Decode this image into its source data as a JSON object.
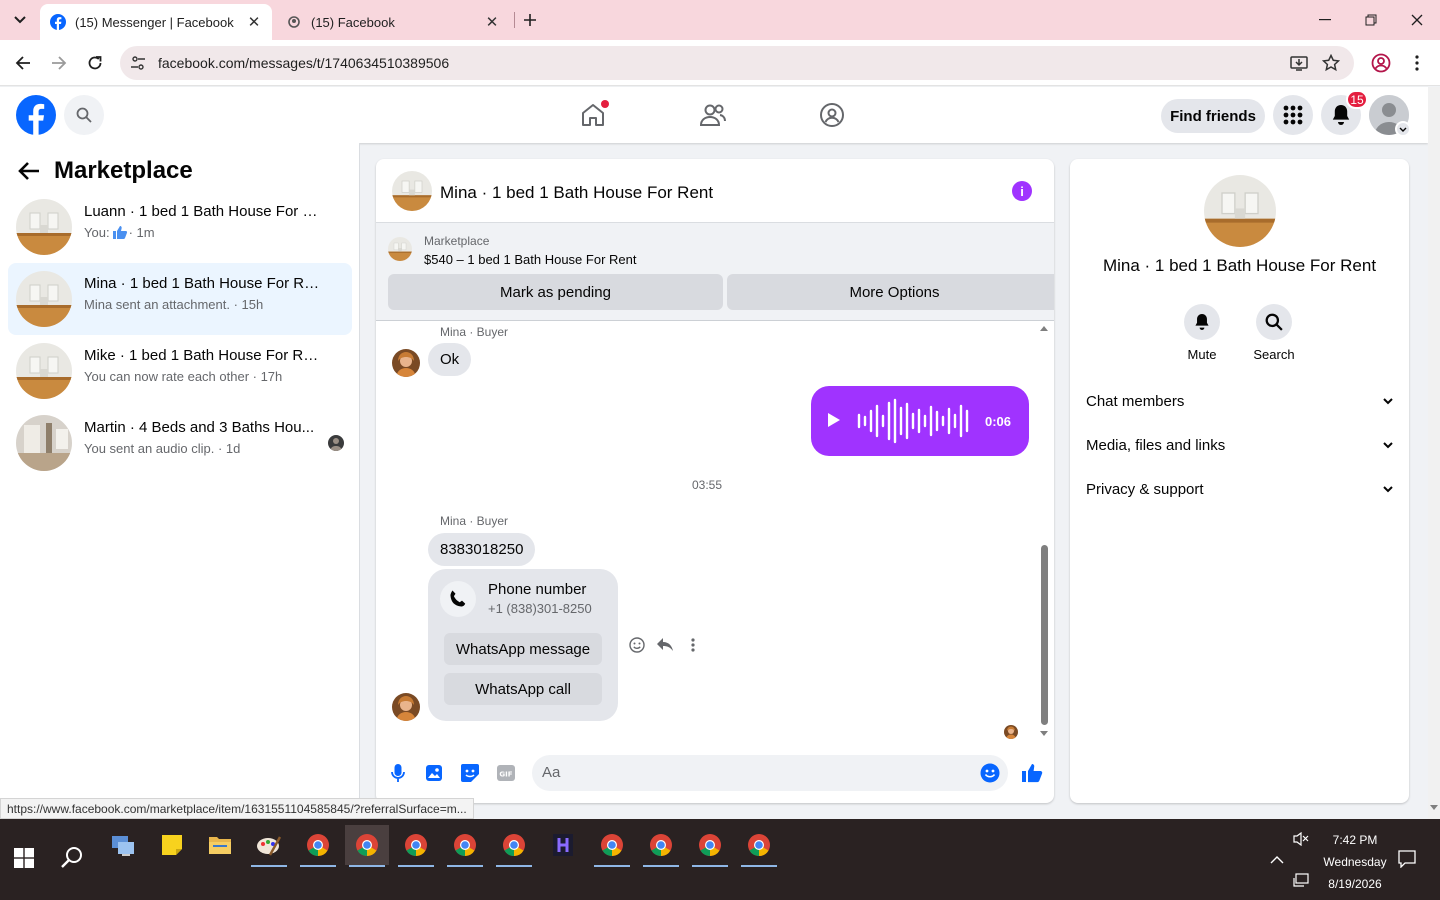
{
  "browser": {
    "tabs": [
      {
        "title": "(15) Messenger | Facebook",
        "active": true
      },
      {
        "title": "(15) Facebook",
        "active": false
      }
    ],
    "url": "facebook.com/messages/t/1740634510389506",
    "status_url": "https://www.facebook.com/marketplace/item/1631551104585845/?referralSurface=m..."
  },
  "header": {
    "find_friends": "Find friends",
    "notification_count": "15",
    "icons": [
      "facebook-logo",
      "search-icon",
      "home-icon",
      "friends-icon",
      "groups-icon",
      "grid-menu-icon",
      "bell-icon",
      "avatar"
    ]
  },
  "sidebar": {
    "title": "Marketplace",
    "conversations": [
      {
        "name": "Luann · 1 bed 1 Bath House For Rent",
        "preview_prefix": "You:",
        "preview": " · 1m",
        "selected": false,
        "has_like": true
      },
      {
        "name": "Mina · 1 bed 1 Bath House For Rent",
        "preview_prefix": "",
        "preview": "Mina sent an attachment. · 15h",
        "selected": true
      },
      {
        "name": "Mike · 1 bed 1 Bath House For Rent",
        "preview_prefix": "",
        "preview": "You can now rate each other · 17h",
        "selected": false
      },
      {
        "name": "Martin · 4 Beds and 3 Baths Hou...",
        "preview_prefix": "",
        "preview": "You sent an audio clip. · 1d",
        "selected": false
      }
    ]
  },
  "chat": {
    "title": "Mina · 1 bed 1 Bath House For Rent",
    "listing_tag": "Marketplace",
    "listing_price": "$540 – 1 bed 1 Bath House For Rent",
    "mark_pending": "Mark as pending",
    "more_options": "More Options",
    "messages": {
      "sender1": "Mina · Buyer",
      "text1": "Ok",
      "audio_duration": "0:06",
      "timestamp": "03:55",
      "sender2": "Mina · Buyer",
      "text2": "8383018250",
      "phone_title": "Phone number",
      "phone_number": "+1 (838)301-8250",
      "whatsapp_message": "WhatsApp message",
      "whatsapp_call": "WhatsApp call"
    },
    "composer_placeholder": "Aa",
    "accent": "#a033ff",
    "brand": "#0866ff"
  },
  "info_panel": {
    "name": "Mina · 1 bed 1 Bath House For Rent",
    "actions": [
      {
        "label": "Mute",
        "icon": "bell-icon"
      },
      {
        "label": "Search",
        "icon": "search-icon"
      }
    ],
    "sections": [
      "Chat members",
      "Media, files and links",
      "Privacy & support"
    ]
  },
  "taskbar": {
    "time": "7:42 PM",
    "day": "Wednesday",
    "date": "8/19/2026"
  }
}
